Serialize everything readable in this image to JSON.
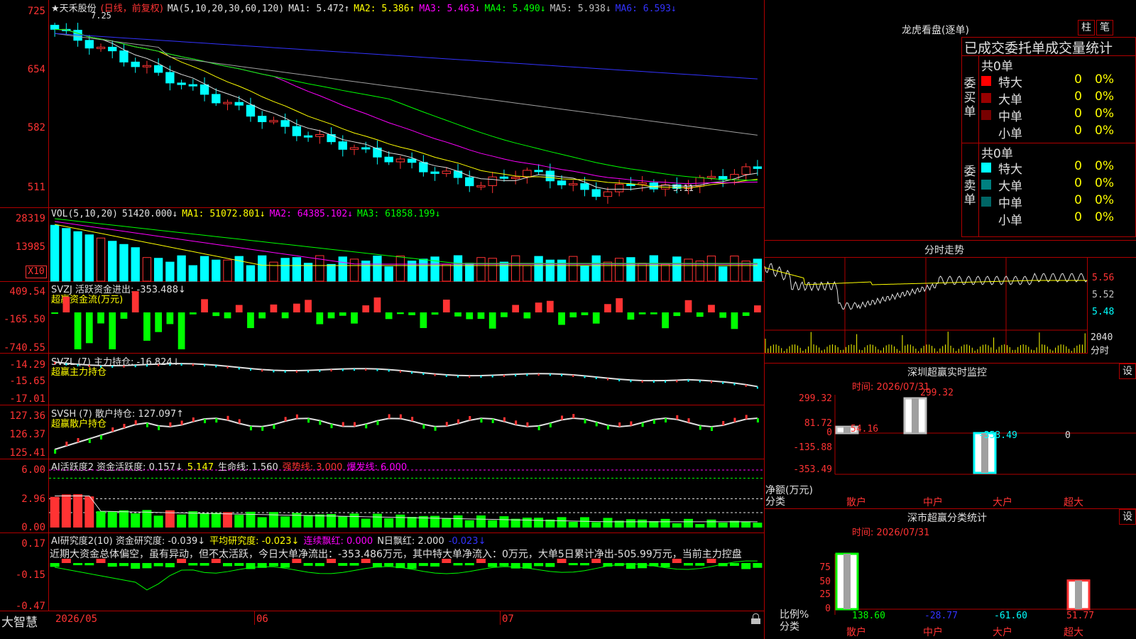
{
  "stock": {
    "name": "★天禾股份",
    "period": "(日线，前复权)",
    "ma_label": "MA(5,10,20,30,60,120)",
    "ma_items": [
      {
        "label": "MA1: 5.472↑",
        "color": "#e0e0e0"
      },
      {
        "label": "MA2: 5.386↑",
        "color": "#ffff00"
      },
      {
        "label": "MA3: 5.463↓",
        "color": "#ff00ff"
      },
      {
        "label": "MA4: 5.490↓",
        "color": "#00ff00"
      },
      {
        "label": "MA5: 5.938↓",
        "color": "#c0c0c0"
      },
      {
        "label": "MA6: 6.593↓",
        "color": "#3333ff"
      }
    ],
    "price_axis": [
      "725",
      "654",
      "582",
      "511"
    ],
    "high_label": "7.25",
    "low_label": "5.11"
  },
  "volume": {
    "legend": "VOL(5,10,20)",
    "value": "51420.000↓",
    "ma_items": [
      {
        "label": "MA1: 51072.801↓",
        "color": "#ffff00"
      },
      {
        "label": "MA2: 64385.102↓",
        "color": "#ff00ff"
      },
      {
        "label": "MA3: 61858.199↓",
        "color": "#00ff00"
      }
    ],
    "axis": [
      "28319",
      "13985"
    ],
    "unit_badge": "X10"
  },
  "svzj": {
    "legend": "SVZJ  活跃资金进出: -353.488↓",
    "subtitle": "超赢资金流(万元)",
    "axis": [
      "409.54",
      "-165.50",
      "-740.55"
    ]
  },
  "svzl": {
    "legend": "SVZL (7) 主力持仓: -16.824↓",
    "subtitle": "超赢主力持仓",
    "axis": [
      "-14.29",
      "-15.65",
      "-17.01"
    ]
  },
  "svsh": {
    "legend": "SVSH (7) 散户持仓: 127.097↑",
    "subtitle": "超赢散户持仓",
    "axis": [
      "127.36",
      "126.37",
      "125.41"
    ]
  },
  "ai_active": {
    "items": [
      {
        "label": "AI活跃度2 资金活跃度: 0.157↓",
        "color": "#e0e0e0"
      },
      {
        "label": "5.147",
        "color": "#ffff00"
      },
      {
        "label": "生命线: 1.560",
        "color": "#e0e0e0"
      },
      {
        "label": "强势线: 3.000",
        "color": "#ff3333"
      },
      {
        "label": "爆发线: 6.000",
        "color": "#ff00ff"
      }
    ],
    "axis": [
      "6.00",
      "2.96",
      "0.00"
    ]
  },
  "ai_research": {
    "items": [
      {
        "label": "AI研究度2(10) 资金研究度: -0.039↓",
        "color": "#e0e0e0"
      },
      {
        "label": "平均研究度: -0.023↓",
        "color": "#ffff00"
      },
      {
        "label": "连续飘红: 0.000",
        "color": "#ff00ff"
      },
      {
        "label": "N日飘红: 2.000",
        "color": "#e0e0e0"
      },
      {
        "label": "-0.023↓",
        "color": "#3333ff"
      }
    ],
    "comment": "近期大资金总体偏空，虽有异动，但不太活跃，今日大单净流出：-353.486万元，其中特大单净流入：0万元，大单5日累计净出-505.99万元，当前主力控盘",
    "axis": [
      "0.17",
      "-0.15",
      "-0.47"
    ]
  },
  "bottom": {
    "app_name": "大智慧",
    "dates": [
      "2026/05",
      "06",
      "07"
    ]
  },
  "longhu": {
    "title": "龙虎看盘(逐单)",
    "btn1": "柱",
    "btn2": "笔",
    "header": "已成交委托单成交量统计",
    "buy_side": "委买单",
    "sell_side": "委卖单",
    "buy_total": "共0单",
    "sell_total": "共0单",
    "buy_rows": [
      {
        "label": "特大",
        "value": "0",
        "pct": "0%",
        "color": "#ff0000"
      },
      {
        "label": "大单",
        "value": "0",
        "pct": "0%",
        "color": "#990000"
      },
      {
        "label": "中单",
        "value": "0",
        "pct": "0%",
        "color": "#770000"
      },
      {
        "label": "小单",
        "value": "0",
        "pct": "0%",
        "color": "#000000"
      }
    ],
    "sell_rows": [
      {
        "label": "特大",
        "value": "0",
        "pct": "0%",
        "color": "#00ffff"
      },
      {
        "label": "大单",
        "value": "0",
        "pct": "0%",
        "color": "#008080"
      },
      {
        "label": "中单",
        "value": "0",
        "pct": "0%",
        "color": "#006666"
      },
      {
        "label": "小单",
        "value": "0",
        "pct": "0%",
        "color": "#000000"
      }
    ]
  },
  "intraday": {
    "title": "分时走势",
    "axis": [
      "5.56",
      "5.52",
      "5.48"
    ],
    "vol_label": "2040",
    "vol_unit": "分时"
  },
  "monitor": {
    "title": "深圳超赢实时监控",
    "settings": "设",
    "time": "时间: 2026/07/31",
    "axis": [
      "299.32",
      "81.72",
      "0",
      "-135.88",
      "-353.49"
    ],
    "net_label": "净额(万元)",
    "cat_label": "分类",
    "categories": [
      "散户",
      "中户",
      "大户",
      "超大"
    ],
    "values": [
      54.16,
      299.32,
      -353.49,
      0
    ],
    "value_labels": [
      "54.16",
      "299.32",
      "-353.49",
      "0"
    ]
  },
  "classify": {
    "title": "深市超赢分类统计",
    "settings": "设",
    "time": "时间: 2026/07/31",
    "axis": [
      "75",
      "50",
      "25",
      "0"
    ],
    "ratio_label": "比例%",
    "cat_label": "分类",
    "categories": [
      "散户",
      "中户",
      "大户",
      "超大"
    ],
    "value_labels": [
      "138.60",
      "-28.77",
      "-61.60",
      "51.77"
    ],
    "value_colors": [
      "#00ff00",
      "#3333ff",
      "#00ffff",
      "#ff3333"
    ]
  }
}
